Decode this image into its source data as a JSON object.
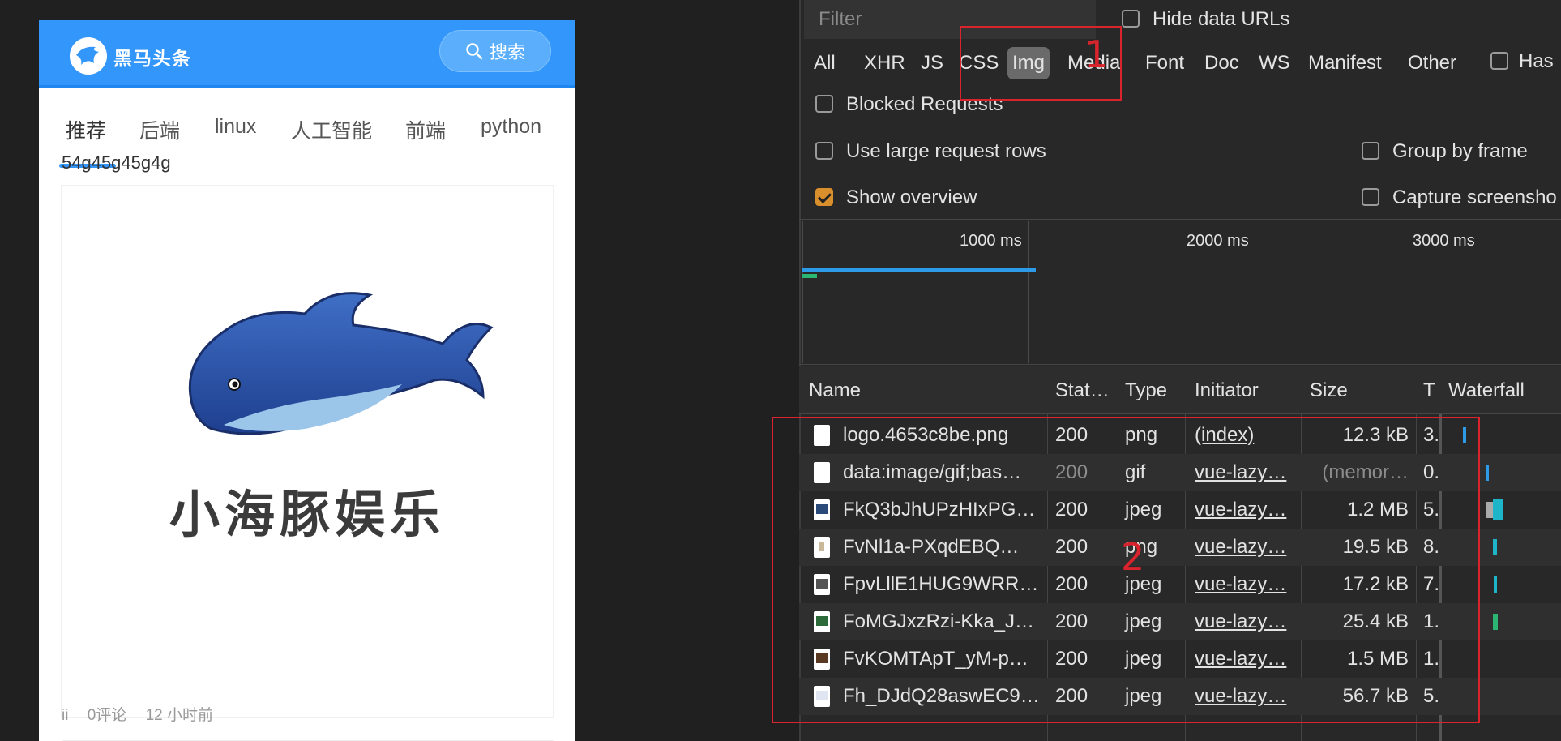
{
  "app": {
    "title": "黑马头条",
    "search_label": "搜索",
    "tabs": [
      "推荐",
      "后端",
      "linux",
      "人工智能",
      "前端",
      "python"
    ],
    "active_tab": "推荐",
    "article": {
      "title": "54g45g45g4g",
      "image_text": "小海豚娱乐",
      "author": "ii",
      "comments": "0评论",
      "time": "12 小时前"
    }
  },
  "devtools": {
    "filter_placeholder": "Filter",
    "hide_data_urls": "Hide data URLs",
    "type_filters": [
      "All",
      "XHR",
      "JS",
      "CSS",
      "Img",
      "Media",
      "Font",
      "Doc",
      "WS",
      "Manifest",
      "Other"
    ],
    "active_type_filter": "Img",
    "has_blocked_cookies": "Has",
    "blocked_requests": "Blocked Requests",
    "use_large_rows": "Use large request rows",
    "group_by_frame": "Group by frame",
    "show_overview": "Show overview",
    "capture_screenshots": "Capture screensho",
    "overview_ticks": [
      "1000 ms",
      "2000 ms",
      "3000 ms"
    ],
    "columns": [
      "Name",
      "Stat…",
      "Type",
      "Initiator",
      "Size",
      "T",
      "Waterfall"
    ],
    "rows": [
      {
        "name": "logo.4653c8be.png",
        "status": "200",
        "type": "png",
        "initiator": "(index)",
        "size": "12.3 kB",
        "time": "3."
      },
      {
        "name": "data:image/gif;bas…",
        "status": "200",
        "type": "gif",
        "initiator": "vue-lazy…",
        "size": "(memor…",
        "time": "0."
      },
      {
        "name": "FkQ3bJhUPzHIxPG…",
        "status": "200",
        "type": "jpeg",
        "initiator": "vue-lazy…",
        "size": "1.2 MB",
        "time": "5."
      },
      {
        "name": "FvNl1a-PXqdEBQ…",
        "status": "200",
        "type": "png",
        "initiator": "vue-lazy…",
        "size": "19.5 kB",
        "time": "8."
      },
      {
        "name": "FpvLllE1HUG9WRR…",
        "status": "200",
        "type": "jpeg",
        "initiator": "vue-lazy…",
        "size": "17.2 kB",
        "time": "7."
      },
      {
        "name": "FoMGJxzRzi-Kka_J…",
        "status": "200",
        "type": "jpeg",
        "initiator": "vue-lazy…",
        "size": "25.4 kB",
        "time": "1."
      },
      {
        "name": "FvKOMTApT_yM-p…",
        "status": "200",
        "type": "jpeg",
        "initiator": "vue-lazy…",
        "size": "1.5 MB",
        "time": "1."
      },
      {
        "name": "Fh_DJdQ28aswEC9…",
        "status": "200",
        "type": "jpeg",
        "initiator": "vue-lazy…",
        "size": "56.7 kB",
        "time": "5."
      }
    ]
  },
  "annotations": [
    "1",
    "2"
  ],
  "colors": {
    "app_blue": "#3296fa",
    "annotation_red": "#d9232d",
    "checkbox_orange": "#d98f2b"
  }
}
